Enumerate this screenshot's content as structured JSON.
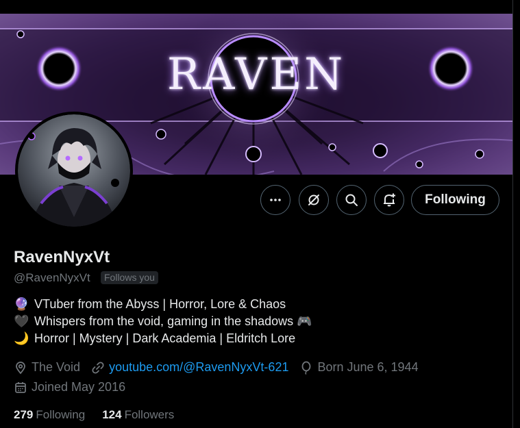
{
  "banner": {
    "title": "RAVEN"
  },
  "actions": {
    "more_icon": "more-icon",
    "grok_icon": "grok-icon",
    "search_icon": "search-icon",
    "notify_icon": "notification-bell-icon",
    "following_label": "Following"
  },
  "profile": {
    "display_name": "RavenNyxVt",
    "handle": "@RavenNyxVt",
    "follows_you": "Follows you",
    "bio": [
      {
        "emoji": "🔮",
        "text": "VTuber from the Abyss | Horror, Lore & Chaos"
      },
      {
        "emoji": "🖤",
        "text": "Whispers from the void, gaming in the shadows 🎮"
      },
      {
        "emoji": "🌙",
        "text": "Horror | Mystery | Dark Academia | Eldritch Lore"
      }
    ],
    "location": "The Void",
    "website": "youtube.com/@RavenNyxVt-621",
    "birthday": "Born June 6, 1944",
    "joined": "Joined May 2016"
  },
  "stats": {
    "following_count": "279",
    "following_label": "Following",
    "followers_count": "124",
    "followers_label": "Followers"
  },
  "colors": {
    "accent": "#1d9bf0",
    "muted": "#71767b",
    "text": "#e7e9ea",
    "border": "#536471"
  }
}
